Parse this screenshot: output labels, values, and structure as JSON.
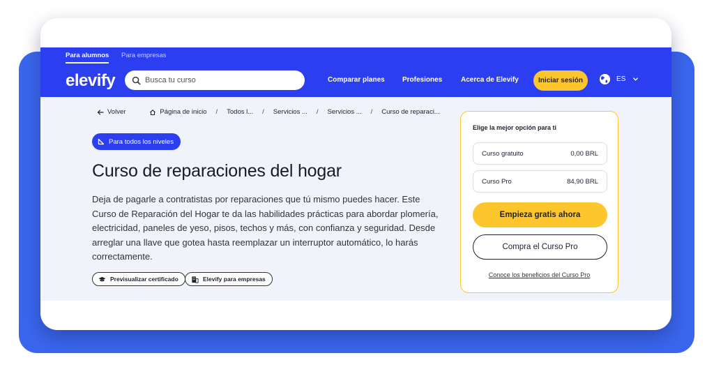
{
  "audience": {
    "students": "Para alumnos",
    "companies": "Para empresas"
  },
  "brand": {
    "logo": "elevify"
  },
  "search": {
    "placeholder": "Busca tu curso"
  },
  "nav": {
    "compare": "Comparar planes",
    "professions": "Profesiones",
    "about": "Acerca de Elevify",
    "login": "Iniciar sesión",
    "language": "ES"
  },
  "breadcrumb": {
    "back": "Volver",
    "home": "Página de inicio",
    "items": [
      "Todos l...",
      "Servicios ...",
      "Servicios ...",
      "Curso de reparaci..."
    ],
    "separator": "/"
  },
  "course": {
    "level": "Para todos los niveles",
    "title": "Curso de reparaciones del hogar",
    "description": "Deja de pagarle a contratistas por reparaciones que tú mismo puedes hacer. Este Curso de Reparación del Hogar te da las habilidades prácticas para abordar plomería, electricidad, paneles de yeso, pisos, techos y más, con confianza y seguridad. Desde arreglar una llave que gotea hasta reemplazar un interruptor automático, lo harás correctamente.",
    "preview_certificate": "Previsualizar certificado",
    "for_companies": "Elevify para empresas"
  },
  "pricing": {
    "title": "Elige la mejor opción para ti",
    "options": [
      {
        "label": "Curso gratuito",
        "price": "0,00 BRL"
      },
      {
        "label": "Curso Pro",
        "price": "84,90 BRL"
      }
    ],
    "start_free": "Empieza gratis ahora",
    "buy_pro": "Compra el Curso Pro",
    "benefits_link": "Conoce los beneficios del Curso Pro"
  },
  "colors": {
    "brand_blue": "#2b3ef0",
    "accent_yellow": "#fdc62d",
    "backdrop_blue": "#3a66ee"
  }
}
